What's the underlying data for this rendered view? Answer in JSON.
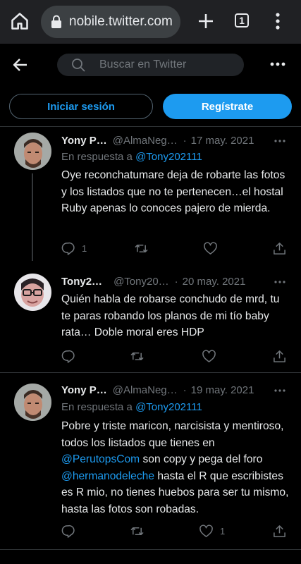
{
  "browser": {
    "url": "nobile.twitter.com",
    "tab_count": "1"
  },
  "header": {
    "search_placeholder": "Buscar en Twitter"
  },
  "auth": {
    "login_label": "Iniciar sesión",
    "signup_label": "Regístrate"
  },
  "tweets": [
    {
      "name": "Yony P…",
      "handle": "@AlmaNeg…",
      "date": "17 may. 2021",
      "reply_prefix": "En respuesta a",
      "reply_mention": "@Tony202111",
      "text": "Oye reconchatumare deja de robarte las fotos y los listados que no te pertenecen…el hostal Ruby apenas lo conoces pajero de mierda.",
      "reply_count": "1",
      "retweet_count": "",
      "like_count": ""
    },
    {
      "name": "Tony2…",
      "handle": "@Tony20…",
      "date": "20 may. 2021",
      "text": "Quién habla de robarse conchudo de mrd, tu te paras robando los planos de mi tío baby rata… Doble moral eres HDP",
      "reply_count": "",
      "retweet_count": "",
      "like_count": ""
    },
    {
      "name": "Yony P…",
      "handle": "@AlmaNeg…",
      "date": "19 may. 2021",
      "reply_prefix": "En respuesta a",
      "reply_mention": "@Tony202111",
      "text_part1": "Pobre y triste maricon, narcisista y mentiroso, todos los listados que tienes en ",
      "mention1": "@PerutopsCom",
      "text_part2": " son copy y pega del foro ",
      "mention2": "@hermanodeleche",
      "text_part3": " hasta el R que escribistes es R mio, no tienes huebos para ser tu mismo, hasta las fotos son robadas.",
      "reply_count": "",
      "retweet_count": "",
      "like_count": "1"
    }
  ],
  "colors": {
    "background": "#000000",
    "accent": "#1d9bf0",
    "text": "#e7e9ea",
    "muted": "#71767b"
  },
  "icons": [
    "home-icon",
    "lock-icon",
    "plus-icon",
    "tab-switcher-icon",
    "kebab-menu-icon",
    "back-arrow-icon",
    "search-icon",
    "more-horizontal-icon",
    "reply-icon",
    "retweet-icon",
    "like-icon",
    "share-icon"
  ]
}
